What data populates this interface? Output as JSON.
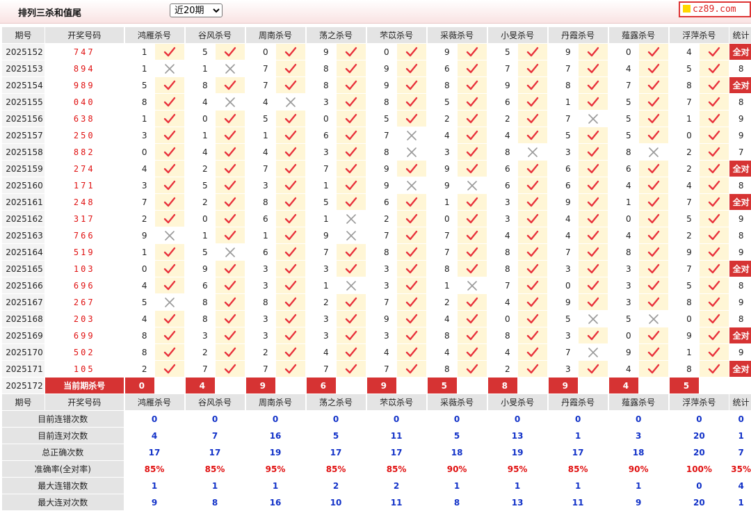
{
  "title": "排列三杀和值尾",
  "period_select": {
    "value": "近20期",
    "options": [
      "近20期"
    ]
  },
  "logo": "cz89.com",
  "headers": [
    "期号",
    "开奖号码",
    "鸿雁杀号",
    "谷风杀号",
    "周南杀号",
    "荡之杀号",
    "芣苡杀号",
    "采薇杀号",
    "小旻杀号",
    "丹霞杀号",
    "薤露杀号",
    "浮萍杀号",
    "统计"
  ],
  "rows": [
    {
      "issue": "2025152",
      "draw": "747",
      "kills": [
        "1",
        "5",
        "0",
        "9",
        "0",
        "9",
        "5",
        "9",
        "0",
        "4"
      ],
      "marks": "1111111111",
      "stat": "全对"
    },
    {
      "issue": "2025153",
      "draw": "894",
      "kills": [
        "1",
        "1",
        "7",
        "8",
        "9",
        "6",
        "7",
        "7",
        "4",
        "5"
      ],
      "marks": "0011111111",
      "stat": "8"
    },
    {
      "issue": "2025154",
      "draw": "989",
      "kills": [
        "5",
        "8",
        "7",
        "8",
        "9",
        "8",
        "9",
        "8",
        "7",
        "8"
      ],
      "marks": "1111111111",
      "stat": "全对"
    },
    {
      "issue": "2025155",
      "draw": "040",
      "kills": [
        "8",
        "4",
        "4",
        "3",
        "8",
        "5",
        "6",
        "1",
        "5",
        "7"
      ],
      "marks": "1001111111",
      "stat": "8"
    },
    {
      "issue": "2025156",
      "draw": "638",
      "kills": [
        "1",
        "0",
        "5",
        "0",
        "5",
        "2",
        "2",
        "7",
        "5",
        "1"
      ],
      "marks": "1111111011",
      "stat": "9"
    },
    {
      "issue": "2025157",
      "draw": "250",
      "kills": [
        "3",
        "1",
        "1",
        "6",
        "7",
        "4",
        "4",
        "5",
        "5",
        "0"
      ],
      "marks": "1111011111",
      "stat": "9"
    },
    {
      "issue": "2025158",
      "draw": "882",
      "kills": [
        "0",
        "4",
        "4",
        "3",
        "8",
        "3",
        "8",
        "3",
        "8",
        "2"
      ],
      "marks": "1111010101",
      "stat": "7"
    },
    {
      "issue": "2025159",
      "draw": "274",
      "kills": [
        "4",
        "2",
        "7",
        "7",
        "9",
        "9",
        "6",
        "6",
        "6",
        "2"
      ],
      "marks": "1111111111",
      "stat": "全对"
    },
    {
      "issue": "2025160",
      "draw": "171",
      "kills": [
        "3",
        "5",
        "3",
        "1",
        "9",
        "9",
        "6",
        "6",
        "4",
        "4"
      ],
      "marks": "1111001111",
      "stat": "8"
    },
    {
      "issue": "2025161",
      "draw": "248",
      "kills": [
        "7",
        "2",
        "8",
        "5",
        "6",
        "1",
        "3",
        "9",
        "1",
        "7"
      ],
      "marks": "1111111111",
      "stat": "全对"
    },
    {
      "issue": "2025162",
      "draw": "317",
      "kills": [
        "2",
        "0",
        "6",
        "1",
        "2",
        "0",
        "3",
        "4",
        "0",
        "5"
      ],
      "marks": "1110111111",
      "stat": "9"
    },
    {
      "issue": "2025163",
      "draw": "766",
      "kills": [
        "9",
        "1",
        "1",
        "9",
        "7",
        "7",
        "4",
        "4",
        "4",
        "2"
      ],
      "marks": "0110111111",
      "stat": "8"
    },
    {
      "issue": "2025164",
      "draw": "519",
      "kills": [
        "1",
        "5",
        "6",
        "7",
        "8",
        "7",
        "8",
        "7",
        "8",
        "9"
      ],
      "marks": "1011111111",
      "stat": "9"
    },
    {
      "issue": "2025165",
      "draw": "103",
      "kills": [
        "0",
        "9",
        "3",
        "3",
        "3",
        "8",
        "8",
        "3",
        "3",
        "7"
      ],
      "marks": "1111111111",
      "stat": "全对"
    },
    {
      "issue": "2025166",
      "draw": "696",
      "kills": [
        "4",
        "6",
        "3",
        "1",
        "3",
        "1",
        "7",
        "0",
        "3",
        "5"
      ],
      "marks": "1110101111",
      "stat": "8"
    },
    {
      "issue": "2025167",
      "draw": "267",
      "kills": [
        "5",
        "8",
        "8",
        "2",
        "7",
        "2",
        "4",
        "9",
        "3",
        "8"
      ],
      "marks": "0111111111",
      "stat": "9"
    },
    {
      "issue": "2025168",
      "draw": "203",
      "kills": [
        "4",
        "8",
        "3",
        "3",
        "9",
        "4",
        "0",
        "5",
        "5",
        "0"
      ],
      "marks": "1111111001",
      "stat": "8"
    },
    {
      "issue": "2025169",
      "draw": "699",
      "kills": [
        "8",
        "3",
        "3",
        "3",
        "3",
        "8",
        "8",
        "3",
        "0",
        "9"
      ],
      "marks": "1111111111",
      "stat": "全对"
    },
    {
      "issue": "2025170",
      "draw": "502",
      "kills": [
        "8",
        "2",
        "2",
        "4",
        "4",
        "4",
        "4",
        "7",
        "9",
        "1"
      ],
      "marks": "1111111011",
      "stat": "9"
    },
    {
      "issue": "2025171",
      "draw": "105",
      "kills": [
        "2",
        "7",
        "7",
        "7",
        "7",
        "8",
        "2",
        "3",
        "4",
        "8"
      ],
      "marks": "1111111111",
      "stat": "全对"
    }
  ],
  "current": {
    "issue": "2025172",
    "label": "当前期杀号",
    "kills": [
      "0",
      "4",
      "9",
      "6",
      "9",
      "5",
      "8",
      "9",
      "4",
      "5"
    ]
  },
  "summary": [
    {
      "label": "目前连错次数",
      "values": [
        "0",
        "0",
        "0",
        "0",
        "0",
        "0",
        "0",
        "0",
        "0",
        "0",
        "0"
      ]
    },
    {
      "label": "目前连对次数",
      "values": [
        "4",
        "7",
        "16",
        "5",
        "11",
        "5",
        "13",
        "1",
        "3",
        "20",
        "1"
      ]
    },
    {
      "label": "总正确次数",
      "values": [
        "17",
        "17",
        "19",
        "17",
        "17",
        "18",
        "19",
        "17",
        "18",
        "20",
        "7"
      ]
    },
    {
      "label": "准确率(全对率)",
      "values": [
        "85%",
        "85%",
        "95%",
        "85%",
        "85%",
        "90%",
        "95%",
        "85%",
        "90%",
        "100%",
        "35%"
      ],
      "pct": true
    },
    {
      "label": "最大连错次数",
      "values": [
        "1",
        "1",
        "1",
        "2",
        "2",
        "1",
        "1",
        "1",
        "1",
        "0",
        "4"
      ]
    },
    {
      "label": "最大连对次数",
      "values": [
        "9",
        "8",
        "16",
        "10",
        "11",
        "8",
        "13",
        "11",
        "9",
        "20",
        "1"
      ]
    }
  ]
}
